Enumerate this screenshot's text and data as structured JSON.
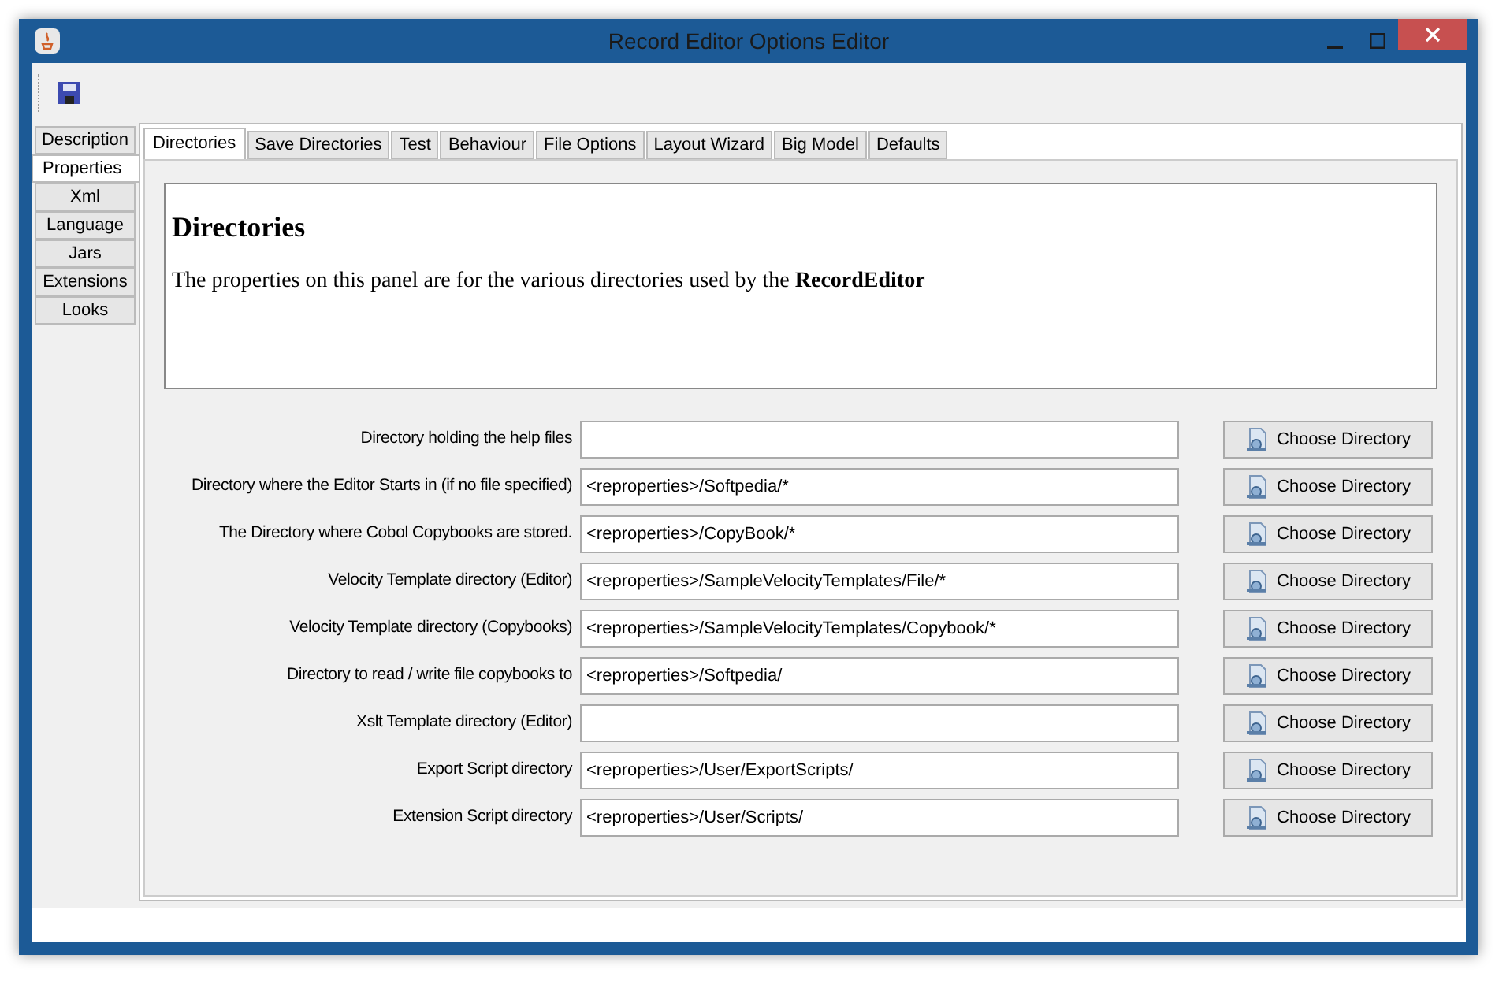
{
  "window": {
    "title": "Record Editor Options Editor"
  },
  "side_tabs": [
    {
      "label": "Description",
      "selected": false
    },
    {
      "label": "Properties",
      "selected": true
    },
    {
      "label": "Xml",
      "selected": false
    },
    {
      "label": "Language",
      "selected": false
    },
    {
      "label": "Jars",
      "selected": false
    },
    {
      "label": "Extensions",
      "selected": false
    },
    {
      "label": "Looks",
      "selected": false
    }
  ],
  "tabs": [
    {
      "label": "Directories",
      "selected": true
    },
    {
      "label": "Save Directories",
      "selected": false
    },
    {
      "label": "Test",
      "selected": false
    },
    {
      "label": "Behaviour",
      "selected": false
    },
    {
      "label": "File Options",
      "selected": false
    },
    {
      "label": "Layout Wizard",
      "selected": false
    },
    {
      "label": "Big Model",
      "selected": false
    },
    {
      "label": "Defaults",
      "selected": false
    }
  ],
  "help": {
    "heading": "Directories",
    "text": "The properties on this panel are for the various directories used by the **RecordEditor**"
  },
  "rows": [
    {
      "label": "Directory holding the help files",
      "value": "",
      "button": "Choose Directory"
    },
    {
      "label": "Directory where the Editor Starts in (if no file specified)",
      "value": "<reproperties>/Softpedia/*",
      "button": "Choose Directory"
    },
    {
      "label": "The Directory where Cobol Copybooks are stored.",
      "value": "<reproperties>/CopyBook/*",
      "button": "Choose Directory"
    },
    {
      "label": "Velocity Template directory (Editor)",
      "value": "<reproperties>/SampleVelocityTemplates/File/*",
      "button": "Choose Directory"
    },
    {
      "label": "Velocity Template directory (Copybooks)",
      "value": "<reproperties>/SampleVelocityTemplates/Copybook/*",
      "button": "Choose Directory"
    },
    {
      "label": "Directory to read / write file copybooks to",
      "value": "<reproperties>/Softpedia/",
      "button": "Choose Directory"
    },
    {
      "label": "Xslt Template directory (Editor)",
      "value": "",
      "button": "Choose Directory"
    },
    {
      "label": "Export Script directory",
      "value": "<reproperties>/User/ExportScripts/",
      "button": "Choose Directory"
    },
    {
      "label": "Extension Script directory",
      "value": "<reproperties>/User/Scripts/",
      "button": "Choose Directory"
    }
  ]
}
